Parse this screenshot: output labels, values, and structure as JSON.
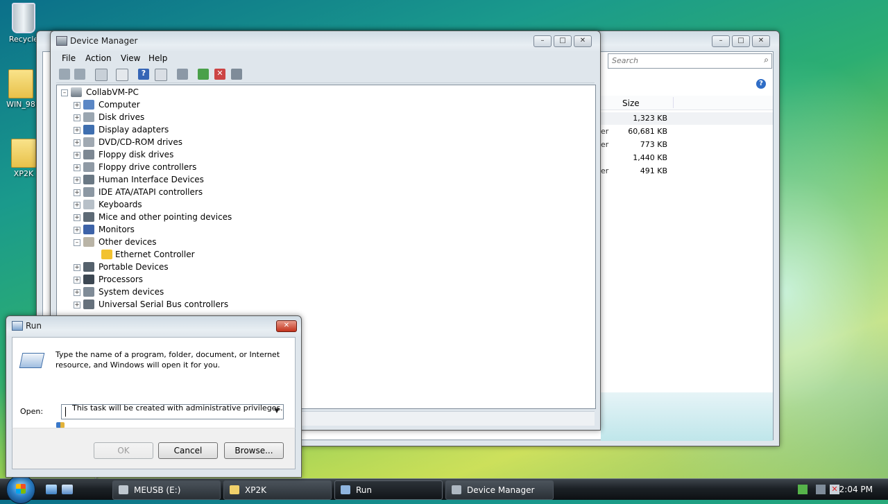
{
  "desktop": {
    "icons": [
      {
        "label": "Recycle"
      },
      {
        "label": "WIN_98"
      },
      {
        "label": "XP2K"
      }
    ]
  },
  "explorer": {
    "search_placeholder": "Search",
    "size_header": "Size",
    "rows": [
      {
        "type_fragment": "",
        "size": "1,323 KB"
      },
      {
        "type_fragment": "er",
        "size": "60,681 KB"
      },
      {
        "type_fragment": "er",
        "size": "773 KB"
      },
      {
        "type_fragment": "",
        "size": "1,440 KB"
      },
      {
        "type_fragment": "er",
        "size": "491 KB"
      }
    ]
  },
  "device_manager": {
    "title": "Device Manager",
    "menu": [
      "File",
      "Action",
      "View",
      "Help"
    ],
    "root": "CollabVM-PC",
    "categories": [
      "Computer",
      "Disk drives",
      "Display adapters",
      "DVD/CD-ROM drives",
      "Floppy disk drives",
      "Floppy drive controllers",
      "Human Interface Devices",
      "IDE ATA/ATAPI controllers",
      "Keyboards",
      "Mice and other pointing devices",
      "Monitors",
      "Other devices",
      "Ethernet Controller",
      "Portable Devices",
      "Processors",
      "System devices",
      "Universal Serial Bus controllers"
    ]
  },
  "run": {
    "title": "Run",
    "description": "Type the name of a program, folder, document, or Internet resource, and Windows will open it for you.",
    "open_label": "Open:",
    "open_value": "",
    "admin_note": "This task will be created with administrative privileges.",
    "ok_label": "OK",
    "cancel_label": "Cancel",
    "browse_label": "Browse..."
  },
  "taskbar": {
    "tasks": [
      {
        "label": "MEUSB (E:)"
      },
      {
        "label": "XP2K"
      },
      {
        "label": "Run"
      },
      {
        "label": "Device Manager"
      }
    ],
    "clock": "2:04 PM"
  },
  "colors": {
    "accent": "#2b7fc6",
    "warning": "#f2c230",
    "close_red": "#c3331d"
  }
}
